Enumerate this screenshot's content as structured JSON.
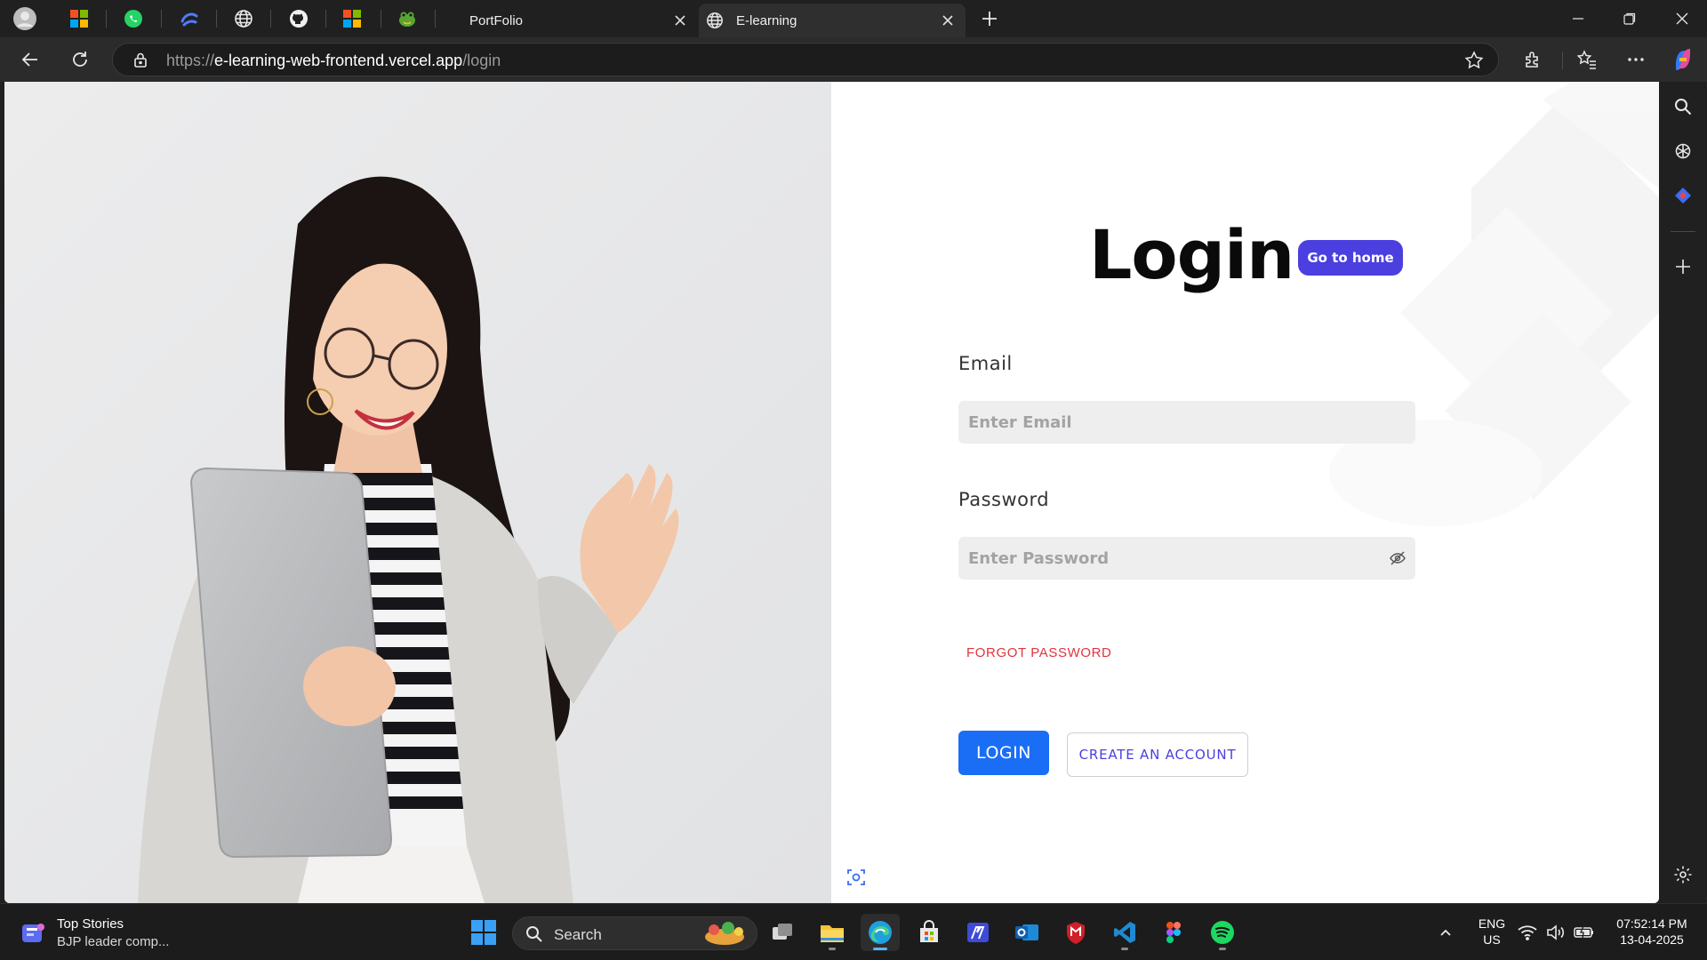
{
  "browser": {
    "tabs": [
      {
        "title": "PortFolio",
        "active": false
      },
      {
        "title": "E-learning",
        "active": true
      }
    ],
    "url": {
      "scheme": "https://",
      "host": "e-learning-web-frontend.vercel.app",
      "path": "/login"
    },
    "pinned_icons": [
      "profile-avatar-icon",
      "microsoft-store-icon",
      "whatsapp-icon",
      "curved-arrow-icon",
      "globe-icon",
      "github-icon",
      "microsoft-icon",
      "frog-icon"
    ]
  },
  "page": {
    "title": "Login",
    "go_home": "Go to home",
    "email_label": "Email",
    "email_placeholder": "Enter Email",
    "password_label": "Password",
    "password_placeholder": "Enter Password",
    "forgot": "FORGOT PASSWORD",
    "login_button": "LOGIN",
    "create_button": "CREATE AN ACCOUNT"
  },
  "taskbar": {
    "news_title": "Top Stories",
    "news_subtitle": "BJP leader comp...",
    "search_label": "Search",
    "language_top": "ENG",
    "language_bottom": "US",
    "time": "07:52:14 PM",
    "date": "13-04-2025"
  },
  "colors": {
    "accent_blue": "#1a6ef6",
    "accent_purple": "#4b3fe0",
    "danger_red": "#e0353e"
  }
}
